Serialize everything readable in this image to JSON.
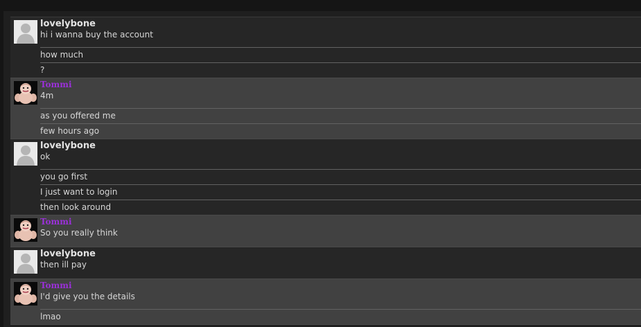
{
  "messages": [
    {
      "user": "lovelybone",
      "avatar": "default-avatar-icon",
      "lines": [
        "hi i wanna buy the account",
        "how much",
        "?"
      ]
    },
    {
      "user": "Tommi",
      "avatar": "cartoon-avatar-icon",
      "lines": [
        "4m",
        "as you offered me",
        "few hours ago"
      ]
    },
    {
      "user": "lovelybone",
      "avatar": "default-avatar-icon",
      "lines": [
        "ok",
        "you go first",
        "I just want to login",
        "then look around"
      ]
    },
    {
      "user": "Tommi",
      "avatar": "cartoon-avatar-icon",
      "lines": [
        "So you really think"
      ]
    },
    {
      "user": "lovelybone",
      "avatar": "default-avatar-icon",
      "lines": [
        "then ill pay"
      ]
    },
    {
      "user": "Tommi",
      "avatar": "cartoon-avatar-icon",
      "lines": [
        "I'd give you the details",
        "lmao"
      ]
    }
  ],
  "colors": {
    "username_tommi": "#9b30d9",
    "username_user": "#e2e2e2",
    "text": "#d6d6d6"
  }
}
